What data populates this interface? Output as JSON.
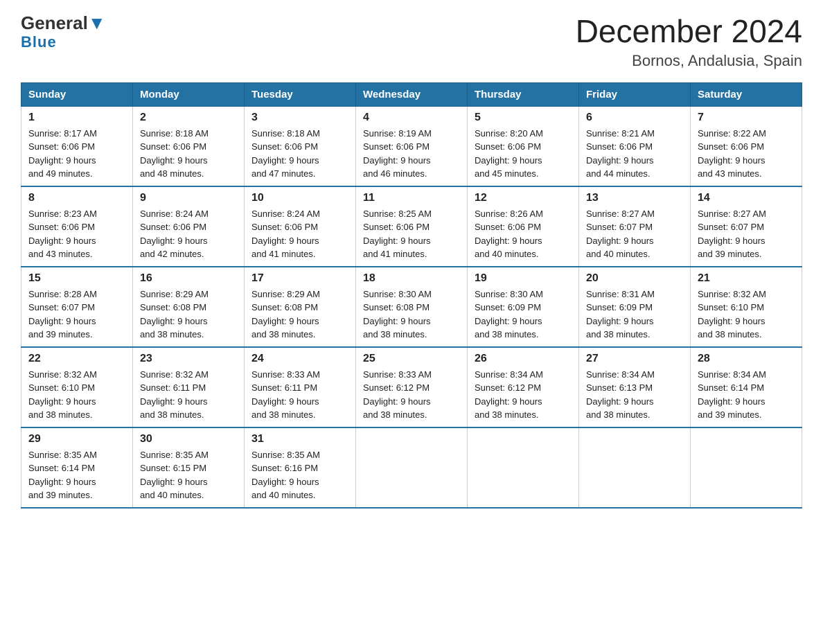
{
  "logo": {
    "general": "General",
    "triangle": "",
    "blue": "Blue"
  },
  "title": "December 2024",
  "subtitle": "Bornos, Andalusia, Spain",
  "weekdays": [
    "Sunday",
    "Monday",
    "Tuesday",
    "Wednesday",
    "Thursday",
    "Friday",
    "Saturday"
  ],
  "weeks": [
    [
      {
        "day": "1",
        "sunrise": "8:17 AM",
        "sunset": "6:06 PM",
        "daylight": "9 hours and 49 minutes."
      },
      {
        "day": "2",
        "sunrise": "8:18 AM",
        "sunset": "6:06 PM",
        "daylight": "9 hours and 48 minutes."
      },
      {
        "day": "3",
        "sunrise": "8:18 AM",
        "sunset": "6:06 PM",
        "daylight": "9 hours and 47 minutes."
      },
      {
        "day": "4",
        "sunrise": "8:19 AM",
        "sunset": "6:06 PM",
        "daylight": "9 hours and 46 minutes."
      },
      {
        "day": "5",
        "sunrise": "8:20 AM",
        "sunset": "6:06 PM",
        "daylight": "9 hours and 45 minutes."
      },
      {
        "day": "6",
        "sunrise": "8:21 AM",
        "sunset": "6:06 PM",
        "daylight": "9 hours and 44 minutes."
      },
      {
        "day": "7",
        "sunrise": "8:22 AM",
        "sunset": "6:06 PM",
        "daylight": "9 hours and 43 minutes."
      }
    ],
    [
      {
        "day": "8",
        "sunrise": "8:23 AM",
        "sunset": "6:06 PM",
        "daylight": "9 hours and 43 minutes."
      },
      {
        "day": "9",
        "sunrise": "8:24 AM",
        "sunset": "6:06 PM",
        "daylight": "9 hours and 42 minutes."
      },
      {
        "day": "10",
        "sunrise": "8:24 AM",
        "sunset": "6:06 PM",
        "daylight": "9 hours and 41 minutes."
      },
      {
        "day": "11",
        "sunrise": "8:25 AM",
        "sunset": "6:06 PM",
        "daylight": "9 hours and 41 minutes."
      },
      {
        "day": "12",
        "sunrise": "8:26 AM",
        "sunset": "6:06 PM",
        "daylight": "9 hours and 40 minutes."
      },
      {
        "day": "13",
        "sunrise": "8:27 AM",
        "sunset": "6:07 PM",
        "daylight": "9 hours and 40 minutes."
      },
      {
        "day": "14",
        "sunrise": "8:27 AM",
        "sunset": "6:07 PM",
        "daylight": "9 hours and 39 minutes."
      }
    ],
    [
      {
        "day": "15",
        "sunrise": "8:28 AM",
        "sunset": "6:07 PM",
        "daylight": "9 hours and 39 minutes."
      },
      {
        "day": "16",
        "sunrise": "8:29 AM",
        "sunset": "6:08 PM",
        "daylight": "9 hours and 38 minutes."
      },
      {
        "day": "17",
        "sunrise": "8:29 AM",
        "sunset": "6:08 PM",
        "daylight": "9 hours and 38 minutes."
      },
      {
        "day": "18",
        "sunrise": "8:30 AM",
        "sunset": "6:08 PM",
        "daylight": "9 hours and 38 minutes."
      },
      {
        "day": "19",
        "sunrise": "8:30 AM",
        "sunset": "6:09 PM",
        "daylight": "9 hours and 38 minutes."
      },
      {
        "day": "20",
        "sunrise": "8:31 AM",
        "sunset": "6:09 PM",
        "daylight": "9 hours and 38 minutes."
      },
      {
        "day": "21",
        "sunrise": "8:32 AM",
        "sunset": "6:10 PM",
        "daylight": "9 hours and 38 minutes."
      }
    ],
    [
      {
        "day": "22",
        "sunrise": "8:32 AM",
        "sunset": "6:10 PM",
        "daylight": "9 hours and 38 minutes."
      },
      {
        "day": "23",
        "sunrise": "8:32 AM",
        "sunset": "6:11 PM",
        "daylight": "9 hours and 38 minutes."
      },
      {
        "day": "24",
        "sunrise": "8:33 AM",
        "sunset": "6:11 PM",
        "daylight": "9 hours and 38 minutes."
      },
      {
        "day": "25",
        "sunrise": "8:33 AM",
        "sunset": "6:12 PM",
        "daylight": "9 hours and 38 minutes."
      },
      {
        "day": "26",
        "sunrise": "8:34 AM",
        "sunset": "6:12 PM",
        "daylight": "9 hours and 38 minutes."
      },
      {
        "day": "27",
        "sunrise": "8:34 AM",
        "sunset": "6:13 PM",
        "daylight": "9 hours and 38 minutes."
      },
      {
        "day": "28",
        "sunrise": "8:34 AM",
        "sunset": "6:14 PM",
        "daylight": "9 hours and 39 minutes."
      }
    ],
    [
      {
        "day": "29",
        "sunrise": "8:35 AM",
        "sunset": "6:14 PM",
        "daylight": "9 hours and 39 minutes."
      },
      {
        "day": "30",
        "sunrise": "8:35 AM",
        "sunset": "6:15 PM",
        "daylight": "9 hours and 40 minutes."
      },
      {
        "day": "31",
        "sunrise": "8:35 AM",
        "sunset": "6:16 PM",
        "daylight": "9 hours and 40 minutes."
      },
      null,
      null,
      null,
      null
    ]
  ],
  "labels": {
    "sunrise": "Sunrise:",
    "sunset": "Sunset:",
    "daylight": "Daylight:"
  }
}
